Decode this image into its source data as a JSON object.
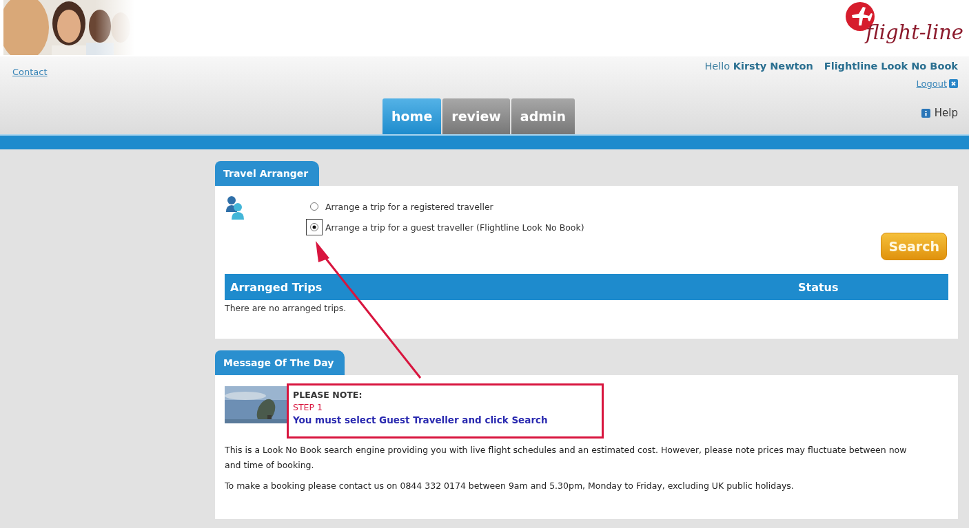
{
  "header": {
    "contact_link": "Contact",
    "logo_text": "flight-line",
    "greeting": "Hello",
    "user_name": "Kirsty Newton",
    "product_name": "Flightline Look No Book",
    "logout": "Logout",
    "help": "Help"
  },
  "nav_tabs": [
    {
      "label": "home",
      "selected": true
    },
    {
      "label": "review",
      "selected": false
    },
    {
      "label": "admin",
      "selected": false
    }
  ],
  "travel_arranger": {
    "title": "Travel Arranger",
    "options": [
      {
        "label": "Arrange a trip for a registered traveller",
        "selected": false
      },
      {
        "label": "Arrange a trip for a guest traveller (Flightline Look No Book)",
        "selected": true
      }
    ],
    "search_button": "Search",
    "table": {
      "columns": [
        "Arranged Trips",
        "Status"
      ],
      "empty_message": "There are no arranged trips."
    }
  },
  "message_of_the_day": {
    "title": "Message Of The Day",
    "note": {
      "heading": "PLEASE NOTE:",
      "step": "STEP 1",
      "instruction": "You must select Guest Traveller and click Search"
    },
    "paragraphs": [
      "This is a Look No Book search engine providing you with live flight schedules and an estimated cost. However, please note prices may fluctuate between now and time of booking.",
      "To make a booking please contact us on 0844 332 0174 between 9am and 5.30pm, Monday to Friday, excluding UK public holidays."
    ]
  }
}
